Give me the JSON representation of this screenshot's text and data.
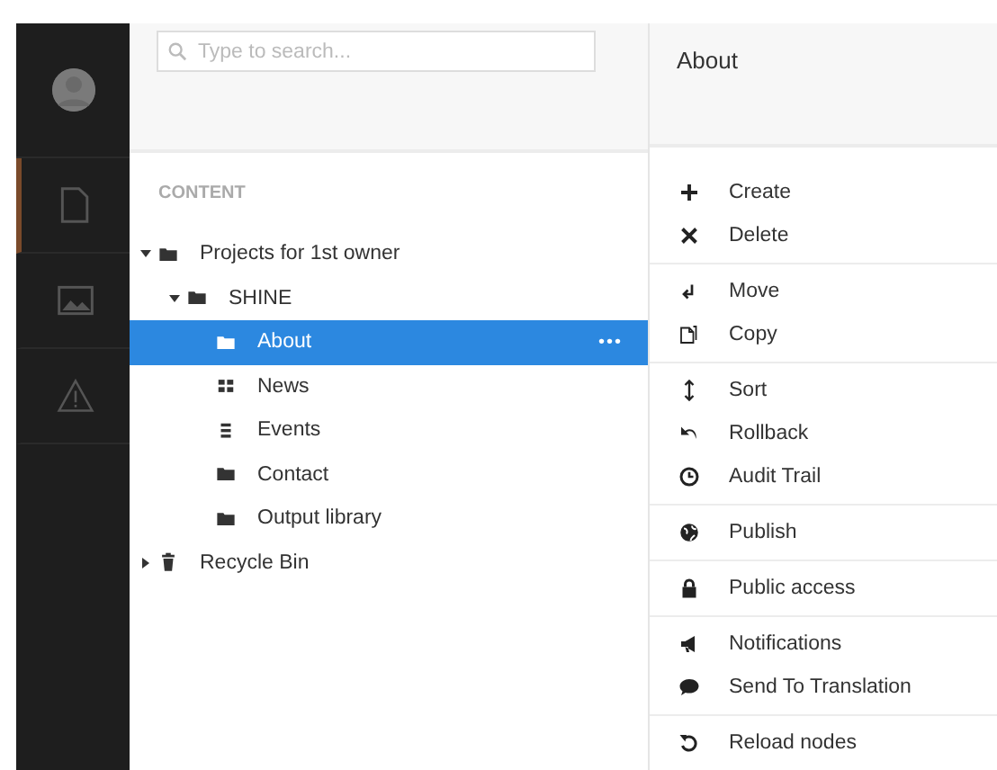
{
  "sidebar": {
    "items": [
      {
        "kind": "document",
        "selected": true
      },
      {
        "kind": "image",
        "selected": false
      },
      {
        "kind": "warning",
        "selected": false
      }
    ]
  },
  "search": {
    "placeholder": "Type to search..."
  },
  "tree": {
    "heading": "CONTENT",
    "items": [
      {
        "label": "Projects for 1st owner",
        "kind": "folder",
        "expanded": true,
        "selected": false,
        "children": [
          {
            "label": "SHINE",
            "kind": "folder",
            "expanded": true,
            "selected": false,
            "children": [
              {
                "label": "About",
                "kind": "folder",
                "selected": true,
                "actions": "•••"
              },
              {
                "label": "News",
                "kind": "grid",
                "selected": false
              },
              {
                "label": "Events",
                "kind": "list",
                "selected": false
              },
              {
                "label": "Contact",
                "kind": "folder",
                "selected": false
              },
              {
                "label": "Output library",
                "kind": "folder",
                "selected": false
              }
            ]
          }
        ]
      },
      {
        "label": "Recycle Bin",
        "kind": "trash",
        "expanded": false,
        "selected": false
      }
    ]
  },
  "panel": {
    "title": "About",
    "groups": [
      [
        {
          "label": "Create",
          "kind": "plus"
        },
        {
          "label": "Delete",
          "kind": "cross"
        }
      ],
      [
        {
          "label": "Move",
          "kind": "move"
        },
        {
          "label": "Copy",
          "kind": "copy"
        }
      ],
      [
        {
          "label": "Sort",
          "kind": "sort"
        },
        {
          "label": "Rollback",
          "kind": "undo"
        },
        {
          "label": "Audit Trail",
          "kind": "clock"
        }
      ],
      [
        {
          "label": "Publish",
          "kind": "globe"
        }
      ],
      [
        {
          "label": "Public access",
          "kind": "lock"
        }
      ],
      [
        {
          "label": "Notifications",
          "kind": "megaphone"
        },
        {
          "label": "Send To Translation",
          "kind": "bubble"
        }
      ],
      [
        {
          "label": "Reload nodes",
          "kind": "reload"
        }
      ]
    ]
  }
}
